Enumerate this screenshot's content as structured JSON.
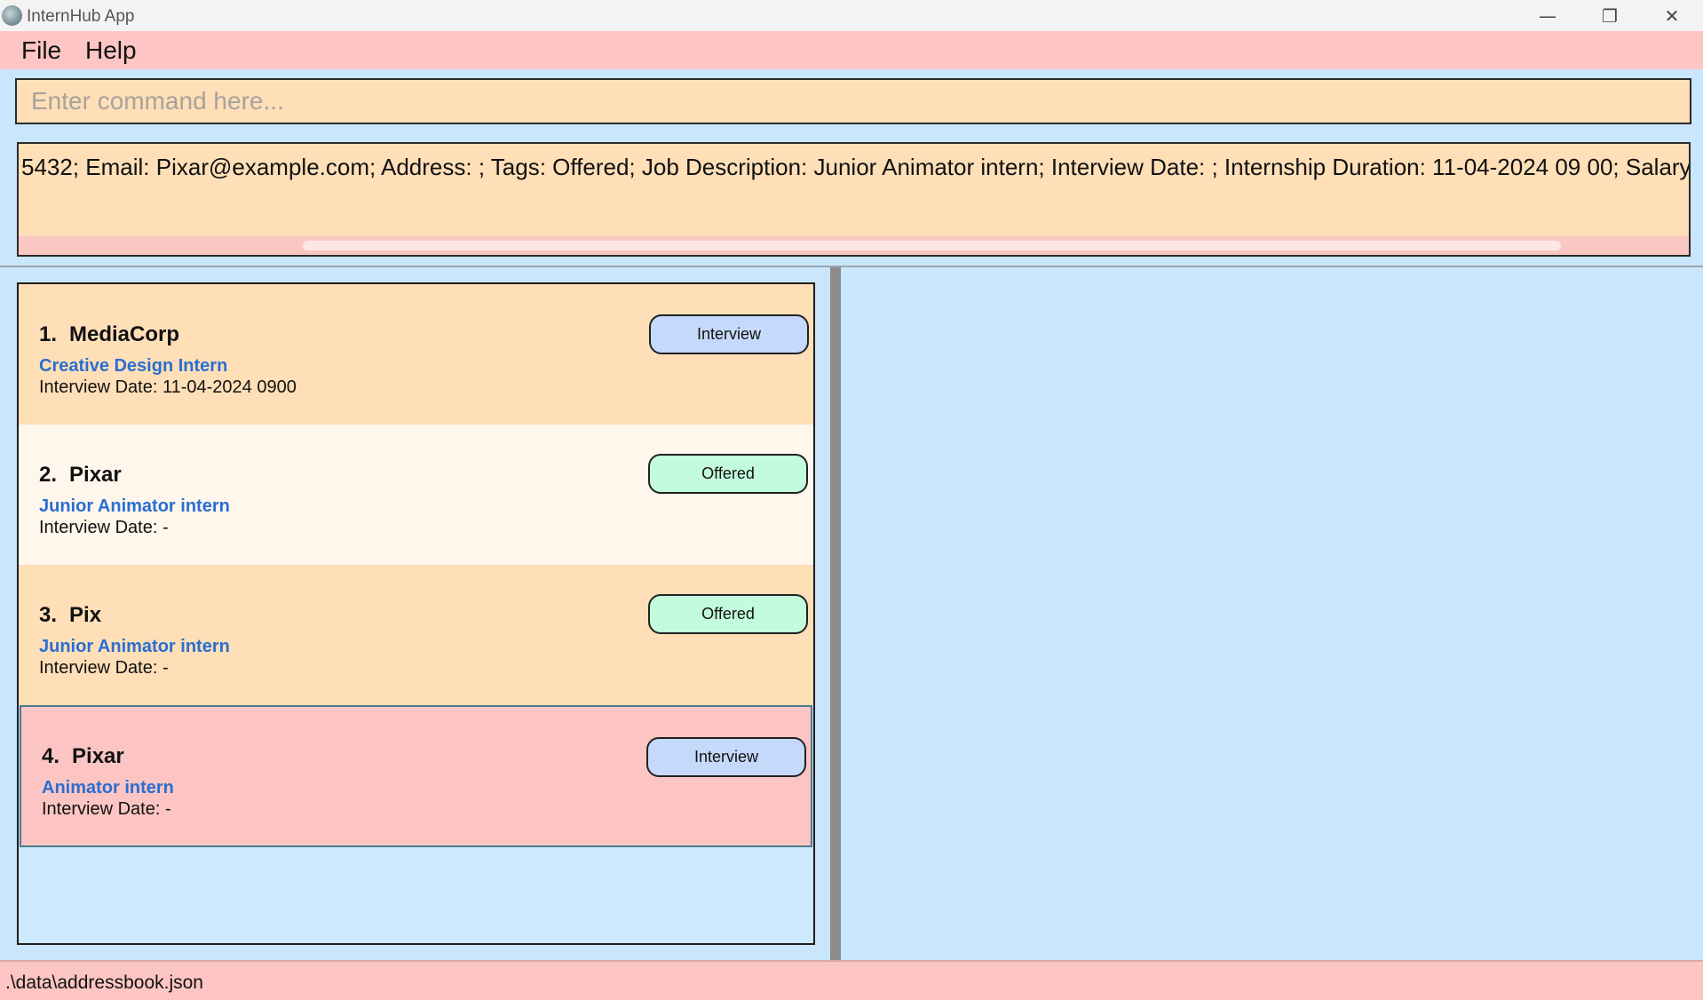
{
  "window": {
    "title": "InternHub App",
    "minimize_glyph": "—",
    "maximize_glyph": "❐",
    "close_glyph": "✕"
  },
  "menu": {
    "file_label": "File",
    "help_label": "Help"
  },
  "command": {
    "placeholder": "Enter command here...",
    "value": ""
  },
  "result": {
    "text": "5432; Email: Pixar@example.com; Address: ; Tags: Offered; Job Description: Junior Animator intern; Interview Date: ; Internship Duration: 11-04-2024 09 00; Salary"
  },
  "cards": [
    {
      "index": "1.",
      "company": "MediaCorp",
      "role": "Creative Design Intern",
      "interview_date": "Interview Date: 11-04-2024 0900",
      "tag": "Interview"
    },
    {
      "index": "2.",
      "company": "Pixar",
      "role": "Junior Animator intern",
      "interview_date": "Interview Date: -",
      "tag": "Offered"
    },
    {
      "index": "3.",
      "company": "Pix",
      "role": "Junior Animator intern",
      "interview_date": "Interview Date: -",
      "tag": "Offered"
    },
    {
      "index": "4.",
      "company": "Pixar",
      "role": "Animator intern",
      "interview_date": "Interview Date: -",
      "tag": "Interview"
    }
  ],
  "status": {
    "file_path": ".\\data\\addressbook.json"
  },
  "colors": {
    "menubar": "#fdc5c3",
    "card_orange": "#ffdfb7",
    "card_light": "#fff6ec",
    "card_selected": "#fcc5c3",
    "tag_interview": "#c5d9fa",
    "tag_offered": "#c3fcdc",
    "role_text": "#2a6ed1",
    "background": "#c9e6fd"
  }
}
